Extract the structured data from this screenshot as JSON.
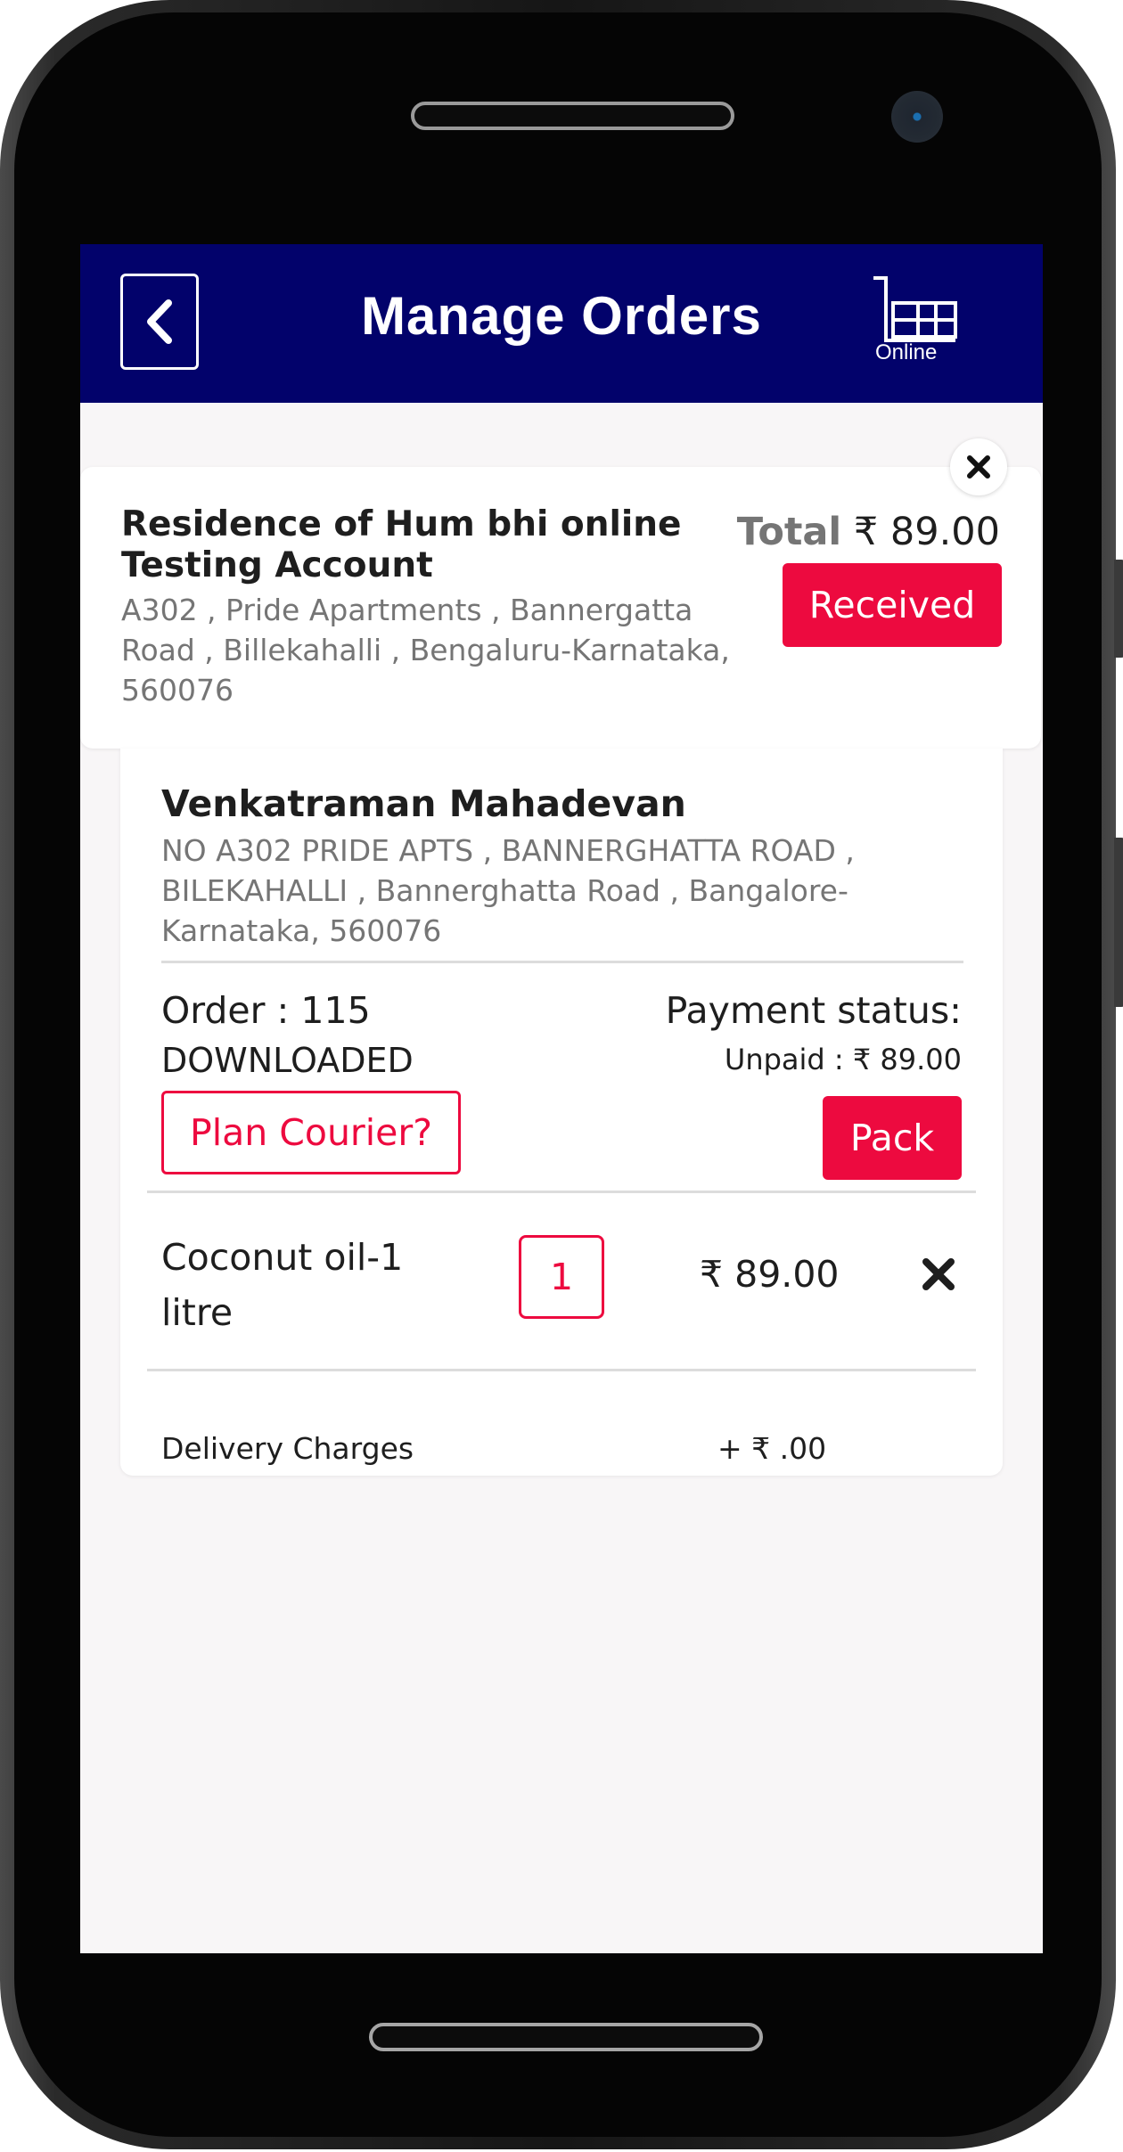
{
  "header": {
    "title": "Manage Orders",
    "logo_text": "Online"
  },
  "shop": {
    "name": "Residence of Hum bhi online Testing Account",
    "address": "A302 , Pride Apartments , Bannergatta Road , Billekahalli , Bengaluru-Karnataka, 560076",
    "total_label": "Total",
    "total_value": "₹ 89.00",
    "status_button": "Received"
  },
  "order": {
    "customer_name": "Venkatraman Mahadevan",
    "customer_address": "NO A302 PRIDE APTS , BANNERGHATTA ROAD , BILEKAHALLI , Bannerghatta Road , Bangalore-Karnataka, 560076",
    "order_label": "Order : 115",
    "order_status": "DOWNLOADED",
    "payment_label": "Payment status:",
    "payment_value": "Unpaid : ₹ 89.00",
    "courier_button": "Plan Courier?",
    "pack_button": "Pack",
    "items": [
      {
        "name": "Coconut oil-1 litre",
        "quantity": "1",
        "price": "₹ 89.00"
      }
    ],
    "delivery_label": "Delivery Charges",
    "delivery_value": "+ ₹ .00"
  },
  "colors": {
    "header_bg": "#02026b",
    "accent": "#ed0a3f",
    "screen_bg": "#f8f6f7"
  }
}
